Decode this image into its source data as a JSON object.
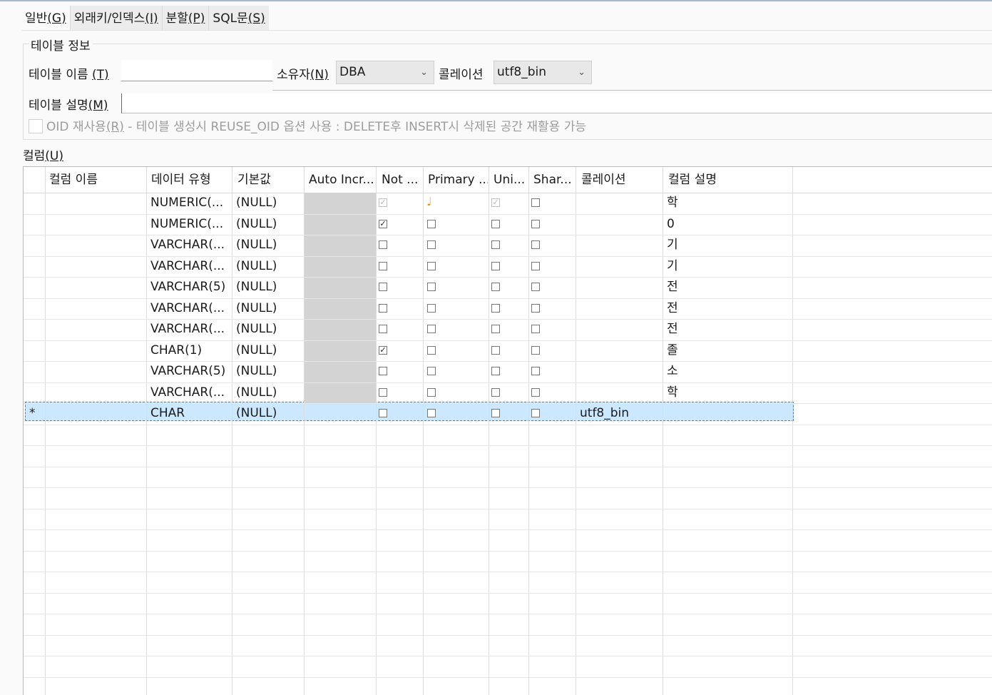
{
  "tabs": [
    {
      "label": "일반",
      "mnemonic": "(G)"
    },
    {
      "label": "외래키/인덱스",
      "mnemonic": "(I)"
    },
    {
      "label": "분할",
      "mnemonic": "(P)"
    },
    {
      "label": "SQL문",
      "mnemonic": "(S)"
    }
  ],
  "table_info": {
    "group_title": "테이블 정보",
    "name_label": "테이블 이름",
    "name_mnemonic": "(T)",
    "name_value": "",
    "owner_label": "소유자",
    "owner_mnemonic": "(N)",
    "owner_value": "DBA",
    "collation_label": "콜레이션",
    "collation_value": "utf8_bin",
    "desc_label": "테이블 설명",
    "desc_mnemonic": "(M)",
    "desc_value": "",
    "oid_label": "OID 재사용",
    "oid_mnemonic": "(R)",
    "oid_desc": " - 테이블 생성시 REUSE_OID 옵션 사용 : DELETE후 INSERT시 삭제된 공간 재활용 가능",
    "oid_checked": false
  },
  "columns_section": {
    "label": "컬럼",
    "mnemonic": "(U)"
  },
  "grid": {
    "headers": [
      "컬럼 이름",
      "데이터 유형",
      "기본값",
      "Auto Incr...",
      "Not ...",
      "Primary ...",
      "Uni...",
      "Shar...",
      "콜레이션",
      "컬럼 설명"
    ],
    "rows": [
      {
        "name": "",
        "type": "NUMERIC(...",
        "default": "(NULL)",
        "not_null": true,
        "pk": true,
        "unique": true,
        "shared": false,
        "collation": "",
        "desc": "학",
        "locked": true
      },
      {
        "name": "",
        "type": "NUMERIC(...",
        "default": "(NULL)",
        "not_null": true,
        "pk": false,
        "unique": false,
        "shared": false,
        "collation": "",
        "desc": "0",
        "locked": false
      },
      {
        "name": "",
        "type": "VARCHAR(...",
        "default": "(NULL)",
        "not_null": false,
        "pk": false,
        "unique": false,
        "shared": false,
        "collation": "",
        "desc": "기",
        "locked": false
      },
      {
        "name": "",
        "type": "VARCHAR(...",
        "default": "(NULL)",
        "not_null": false,
        "pk": false,
        "unique": false,
        "shared": false,
        "collation": "",
        "desc": "기",
        "locked": false
      },
      {
        "name": "",
        "type": "VARCHAR(5)",
        "default": "(NULL)",
        "not_null": false,
        "pk": false,
        "unique": false,
        "shared": false,
        "collation": "",
        "desc": "전",
        "locked": false
      },
      {
        "name": "",
        "type": "VARCHAR(...",
        "default": "(NULL)",
        "not_null": false,
        "pk": false,
        "unique": false,
        "shared": false,
        "collation": "",
        "desc": "전",
        "locked": false
      },
      {
        "name": "",
        "type": "VARCHAR(...",
        "default": "(NULL)",
        "not_null": false,
        "pk": false,
        "unique": false,
        "shared": false,
        "collation": "",
        "desc": "전",
        "locked": false
      },
      {
        "name": "",
        "type": "CHAR(1)",
        "default": "(NULL)",
        "not_null": true,
        "pk": false,
        "unique": false,
        "shared": false,
        "collation": "",
        "desc": "졸",
        "locked": false
      },
      {
        "name": "",
        "type": "VARCHAR(5)",
        "default": "(NULL)",
        "not_null": false,
        "pk": false,
        "unique": false,
        "shared": false,
        "collation": "",
        "desc": "소",
        "locked": false
      },
      {
        "name": "",
        "type": "VARCHAR(...",
        "default": "(NULL)",
        "not_null": false,
        "pk": false,
        "unique": false,
        "shared": false,
        "collation": "",
        "desc": "학",
        "locked": false
      }
    ],
    "new_row": {
      "marker": "*",
      "type": "CHAR",
      "default": "(NULL)",
      "collation": "utf8_bin"
    }
  }
}
